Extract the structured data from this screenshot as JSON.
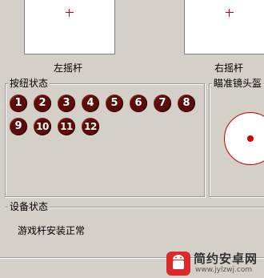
{
  "sticks": {
    "left_label": "左摇杆",
    "right_label": "右摇杆"
  },
  "buttons_group": {
    "title": "按纽状态",
    "buttons": [
      "1",
      "2",
      "3",
      "4",
      "5",
      "6",
      "7",
      "8",
      "9",
      "10",
      "11",
      "12"
    ]
  },
  "aim_group": {
    "title": "瞄准镜头盔"
  },
  "device_group": {
    "title": "设备状态",
    "status_text": "游戏杆安装正常"
  },
  "watermark": {
    "brand": "简约安卓网",
    "url": "www.jylzwj.com"
  },
  "colors": {
    "background": "#d4d0c8",
    "button_fill": "#5a0b0b",
    "crosshair": "#d40000"
  },
  "icons": [
    "crosshair-icon",
    "android-logo-icon"
  ]
}
